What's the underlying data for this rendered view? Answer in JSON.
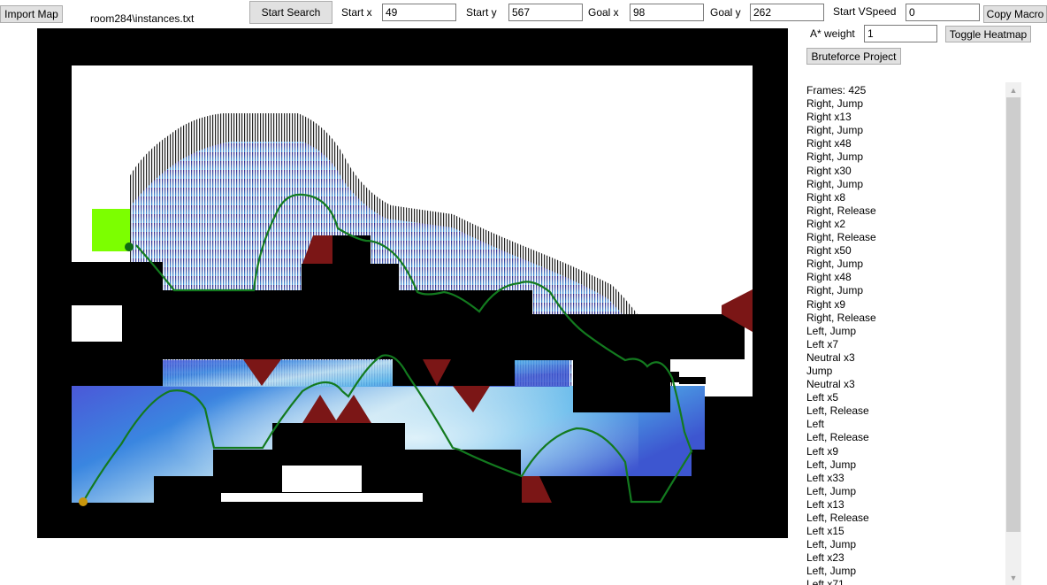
{
  "toolbar": {
    "import_label": "Import Map",
    "map_file": "room284\\instances.txt",
    "start_search_label": "Start Search",
    "start_x_label": "Start x",
    "start_x_value": "49",
    "start_y_label": "Start y",
    "start_y_value": "567",
    "goal_x_label": "Goal x",
    "goal_x_value": "98",
    "goal_y_label": "Goal y",
    "goal_y_value": "262",
    "vspeed_label": "Start VSpeed",
    "vspeed_value": "0",
    "copy_macro_label": "Copy Macro",
    "astar_label": "A* weight",
    "astar_value": "1",
    "heatmap_label": "Toggle Heatmap",
    "bruteforce_label": "Bruteforce Project"
  },
  "output": {
    "lines": [
      "Frames: 425",
      "Right, Jump",
      "Right x13",
      "Right, Jump",
      "Right x48",
      "Right, Jump",
      "Right x30",
      "Right, Jump",
      "Right x8",
      "Right, Release",
      "Right x2",
      "Right, Release",
      "Right x50",
      "Right, Jump",
      "Right x48",
      "Right, Jump",
      "Right x9",
      "Right, Release",
      "Left, Jump",
      "Left x7",
      "Neutral x3",
      "Jump",
      "Neutral x3",
      "Left x5",
      "Left, Release",
      "Left",
      "Left, Release",
      "Left x9",
      "Left, Jump",
      "Left x33",
      "Left, Jump",
      "Left x13",
      "Left, Release",
      "Left x15",
      "Left, Jump",
      "Left x23",
      "Left, Jump",
      "Left x71"
    ]
  },
  "colors": {
    "wall": "#000000",
    "floor": "#ffffff",
    "spike": "#7b1616",
    "goal": "#7cff00",
    "path": "#137a1f",
    "start_marker": "#c8960c",
    "goal_marker": "#0f6b12",
    "heat_hot": "#e6f5fb",
    "heat_mid": "#4aa8e8",
    "heat_cold": "#3d33c8"
  }
}
